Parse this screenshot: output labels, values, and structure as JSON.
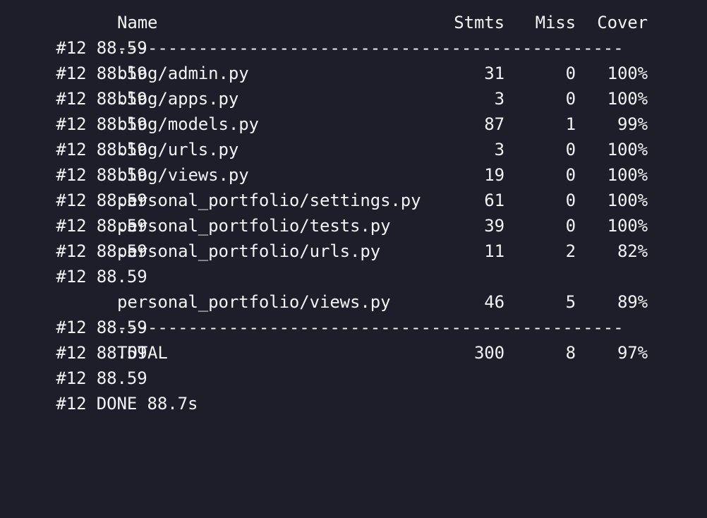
{
  "header": {
    "prefix": "#12 88.59",
    "name": "Name",
    "stmts": "Stmts",
    "miss": "Miss",
    "cover": "Cover"
  },
  "separator": {
    "prefix": "#12 88.59",
    "line": "--------------------------------------------------"
  },
  "rows": [
    {
      "prefix": "#12 88.59",
      "name": "blog/admin.py",
      "stmts": "31",
      "miss": "0",
      "cover": "100%"
    },
    {
      "prefix": "#12 88.59",
      "name": "blog/apps.py",
      "stmts": "3",
      "miss": "0",
      "cover": "100%"
    },
    {
      "prefix": "#12 88.59",
      "name": "blog/models.py",
      "stmts": "87",
      "miss": "1",
      "cover": "99%"
    },
    {
      "prefix": "#12 88.59",
      "name": "blog/urls.py",
      "stmts": "3",
      "miss": "0",
      "cover": "100%"
    },
    {
      "prefix": "#12 88.59",
      "name": "blog/views.py",
      "stmts": "19",
      "miss": "0",
      "cover": "100%"
    },
    {
      "prefix": "#12 88.59",
      "name": "personal_portfolio/settings.py",
      "stmts": "61",
      "miss": "0",
      "cover": "100%"
    },
    {
      "prefix": "#12 88.59",
      "name": "personal_portfolio/tests.py",
      "stmts": "39",
      "miss": "0",
      "cover": "100%"
    },
    {
      "prefix": "#12 88.59",
      "name": "personal_portfolio/urls.py",
      "stmts": "11",
      "miss": "2",
      "cover": "82%"
    },
    {
      "prefix": "#12 88.59",
      "name": "personal_portfolio/views.py",
      "stmts": "46",
      "miss": "5",
      "cover": "89%"
    }
  ],
  "separator2": {
    "prefix": "#12 88.59",
    "line": "--------------------------------------------------"
  },
  "total": {
    "prefix": "#12 88.59",
    "name": "TOTAL",
    "stmts": "300",
    "miss": "8",
    "cover": "97%"
  },
  "done": "#12 DONE 88.7s"
}
